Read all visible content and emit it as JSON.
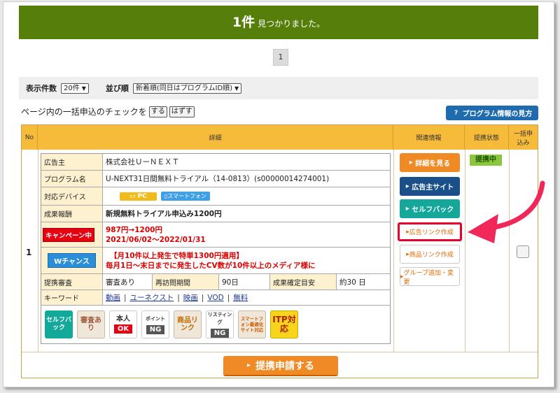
{
  "banner": {
    "count": "1件",
    "found": "見つかりました。"
  },
  "pager": {
    "current": "1"
  },
  "filter": {
    "per_page_label": "表示件数",
    "per_page_value": "20件",
    "sort_label": "並び順",
    "sort_value": "新着順(同日はプログラムID順)"
  },
  "bulk": {
    "text": "ページ内の一括申込のチェックを",
    "do_label": "する",
    "undo_label": "はずす",
    "howto_label": "プログラム情報の見方"
  },
  "table": {
    "headers": {
      "no": "No",
      "detail": "詳細",
      "related": "関連情報",
      "status": "提携状態",
      "bulk": "一括申込み"
    },
    "row_no": "1"
  },
  "detail": {
    "advertiser_label": "広告主",
    "advertiser_value": "株式会社ＵーＮＥＸＴ",
    "program_label": "プログラム名",
    "program_value": "U-NEXT31日間無料トライアル（14-0813）(s00000014274001)",
    "device_label": "対応デバイス",
    "device_pc": "PC",
    "device_sp": "スマートフォン",
    "reward_label": "成果報酬",
    "reward_value": "新規無料トライアル申込み1200円",
    "campaign_badge": "キャンペーン中",
    "campaign_line1": "987円→1200円",
    "campaign_line2": "2021/06/02～2022/01/31",
    "wchance_badge": "Wチャンス",
    "wchance_line1": "【月10件以上発生で特単1300円適用】",
    "wchance_line2": "毎月1日～末日までに発生したCV数が10件以上のメディア様に",
    "review_label": "提携審査",
    "review_value": "審査あり",
    "reapply_label": "再訪問期間",
    "reapply_value": "90日",
    "confirm_label": "成果確定目安",
    "confirm_value": "約30 日",
    "keyword_label": "キーワード",
    "keywords": [
      "動画",
      "ユーネクスト",
      "映画",
      "VOD",
      "無料"
    ]
  },
  "icons": {
    "selfback": "セルフバック",
    "review": "審査あり",
    "identity_top": "本人",
    "identity_bottom": "OK",
    "point_top": "ポイント",
    "point_bottom": "NG",
    "product_link": "商品リンク",
    "listing_top": "リスティング",
    "listing_bottom": "NG",
    "smartphone_opt": "スマートフォン最適化サイト対応",
    "itp": "ITP対応"
  },
  "related": {
    "details": "詳細を見る",
    "advertiser_site": "広告主サイト",
    "selfback": "セルフバック",
    "ad_link": "広告リンク作成",
    "product_link": "商品リンク作成",
    "group": "グループ追加・変更"
  },
  "status": {
    "label": "提携中"
  },
  "apply": {
    "label": "提携申請する"
  },
  "colors": {
    "banner": "#557f0a",
    "header": "#f7bb3b",
    "orange": "#f08a24",
    "navy": "#1b4f8a",
    "teal": "#14a79a",
    "highlight": "#e8002c"
  }
}
